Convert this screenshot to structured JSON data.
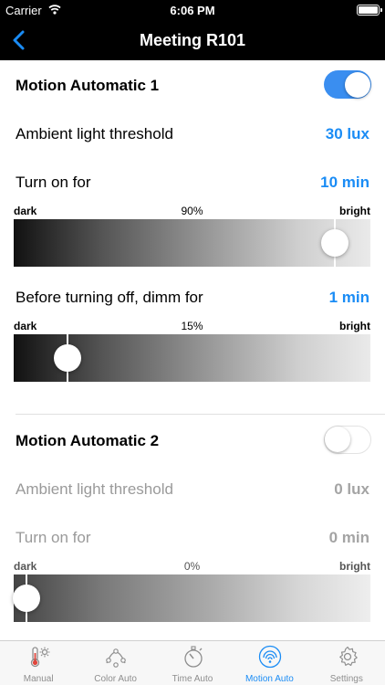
{
  "status": {
    "carrier": "Carrier",
    "time": "6:06 PM"
  },
  "nav": {
    "title": "Meeting R101"
  },
  "auto1": {
    "title": "Motion Automatic 1",
    "enabled": true,
    "ambient_label": "Ambient light threshold",
    "ambient_value": "30 lux",
    "turn_on_label": "Turn on for",
    "turn_on_value": "10 min",
    "slider1": {
      "dark": "dark",
      "percent": "90%",
      "bright": "bright",
      "level": 0.9
    },
    "dimm_label": "Before turning off, dimm for",
    "dimm_value": "1 min",
    "slider2": {
      "dark": "dark",
      "percent": "15%",
      "bright": "bright",
      "level": 0.15
    }
  },
  "auto2": {
    "title": "Motion Automatic 2",
    "enabled": false,
    "ambient_label": "Ambient light threshold",
    "ambient_value": "0 lux",
    "turn_on_label": "Turn on for",
    "turn_on_value": "0 min",
    "slider1": {
      "dark": "dark",
      "percent": "0%",
      "bright": "bright",
      "level": 0.0
    }
  },
  "tabs": [
    {
      "label": "Manual",
      "icon": "thermometer-sun-icon",
      "active": false
    },
    {
      "label": "Color Auto",
      "icon": "color-curve-icon",
      "active": false
    },
    {
      "label": "Time Auto",
      "icon": "stopwatch-icon",
      "active": false
    },
    {
      "label": "Motion Auto",
      "icon": "motion-sensor-icon",
      "active": true
    },
    {
      "label": "Settings",
      "icon": "gear-icon",
      "active": false
    }
  ],
  "colors": {
    "accent": "#1a8cf5",
    "toggle_on": "#3a8ef0",
    "bar": "#000000"
  }
}
